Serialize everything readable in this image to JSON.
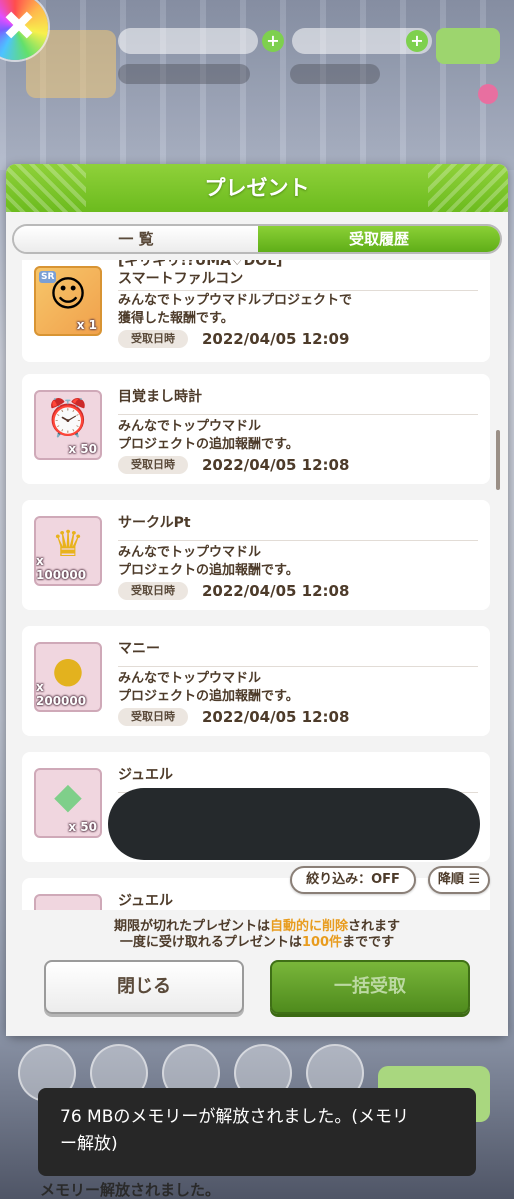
{
  "modal": {
    "title": "プレゼント",
    "tabs": [
      {
        "label": "一 覧",
        "active": false
      },
      {
        "label": "受取履歴",
        "active": true
      }
    ]
  },
  "items": [
    {
      "name_line1": "[ギリギリ!?UMA♡DOL]",
      "name_line2": "スマートファルコン",
      "icon": "character-card-icon",
      "badge": "SR",
      "qty": "x 1",
      "desc_line1": "みんなでトップウマドルプロジェクトで",
      "desc_line2": "獲得した報酬です。",
      "recv_label": "受取日時",
      "recv_date": "2022/04/05 12:09"
    },
    {
      "name": "目覚まし時計",
      "icon": "alarm-clock-icon",
      "qty": "x 50",
      "desc_line1": "みんなでトップウマドル",
      "desc_line2": "プロジェクトの追加報酬です。",
      "recv_label": "受取日時",
      "recv_date": "2022/04/05 12:08"
    },
    {
      "name": "サークルPt",
      "icon": "crown-icon",
      "qty": "x 100000",
      "desc_line1": "みんなでトップウマドル",
      "desc_line2": "プロジェクトの追加報酬です。",
      "recv_label": "受取日時",
      "recv_date": "2022/04/05 12:08"
    },
    {
      "name": "マニー",
      "icon": "coin-icon",
      "qty": "x 200000",
      "desc_line1": "みんなでトップウマドル",
      "desc_line2": "プロジェクトの追加報酬です。",
      "recv_label": "受取日時",
      "recv_date": "2022/04/05 12:08"
    },
    {
      "name": "ジュエル",
      "icon": "jewel-icon",
      "qty": "x 50"
    },
    {
      "name": "ジュエル",
      "icon": "jewel-icon"
    }
  ],
  "filter": {
    "filter_label": "絞り込み：OFF",
    "sort_label": "降順"
  },
  "footer": {
    "notice1_a": "期限が切れたプレゼントは",
    "notice1_hl": "自動的に削除",
    "notice1_b": "されます",
    "notice2_a": "一度に受け取れるプレゼントは",
    "notice2_hl": "100件",
    "notice2_b": "までです",
    "close_label": "閉じる",
    "bulk_label": "一括受取"
  },
  "toast": {
    "line1": "76 MBのメモリーが解放されました。(メモリ",
    "line2": "ー解放)"
  },
  "bottom_text": "メモリー解放されました。"
}
